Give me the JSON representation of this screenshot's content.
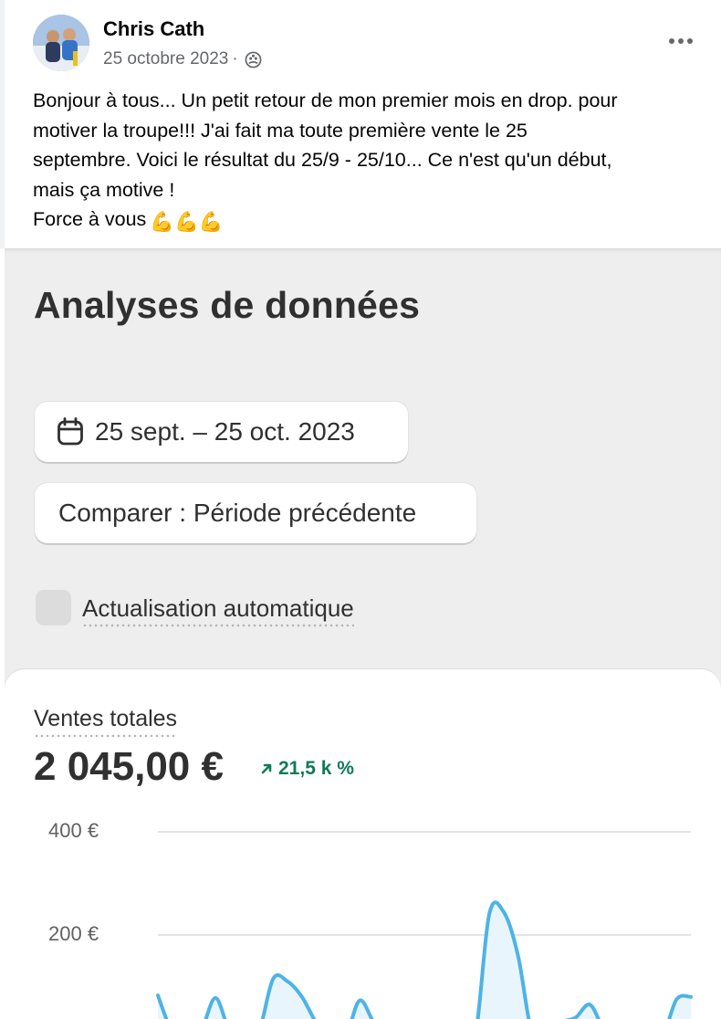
{
  "post": {
    "author": "Chris Cath",
    "date": "25 octobre 2023",
    "separator": "·",
    "lines": [
      "Bonjour à tous... Un petit retour de mon premier mois en drop. pour",
      "motiver la troupe!!! J'ai fait ma toute première vente le 25",
      "septembre. Voici le résultat du 25/9 - 25/10... Ce n'est qu'un début,",
      "mais ça motive !",
      "Force à vous"
    ],
    "emoji": "💪💪💪"
  },
  "analytics": {
    "title": "Analyses de données",
    "date_range": "25 sept. – 25 oct. 2023",
    "compare": "Comparer : Période précédente",
    "auto_refresh": "Actualisation automatique"
  },
  "metric": {
    "label": "Ventes totales",
    "value": "2 045,00 €",
    "change": "21,5 k %",
    "change_color": "#0f7b54"
  },
  "chart_data": {
    "type": "line",
    "title": "",
    "xlabel": "",
    "ylabel": "",
    "y_ticks": [
      "400 €",
      "200 €"
    ],
    "ylim": [
      0,
      400
    ],
    "series": [
      {
        "values": [
          83,
          12,
          0,
          15,
          78,
          12,
          0,
          12,
          115,
          110,
          80,
          30,
          0,
          0,
          73,
          30,
          0,
          0,
          25,
          0,
          0,
          30,
          0,
          240,
          245,
          160,
          5,
          0,
          30,
          40,
          65,
          15,
          0,
          15,
          0,
          0,
          75,
          80
        ]
      }
    ],
    "line_color": "#4db3e6",
    "fill_color": "#e9f5fc",
    "grid": true
  }
}
